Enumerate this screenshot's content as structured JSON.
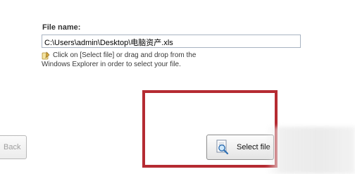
{
  "file_section": {
    "label": "File name:",
    "path_value": "C:\\Users\\admin\\Desktop\\电脑资产.xls"
  },
  "hint": {
    "icon": "note-icon",
    "text": "Click on [Select file] or drag and drop from the Windows Explorer in order to select your file."
  },
  "buttons": {
    "back_label": "Back",
    "select_file_label": "Select file",
    "select_file_icon": "magnifier-document-icon"
  },
  "colors": {
    "highlight_border": "#b52b32",
    "input_border": "#a8b3c2"
  }
}
